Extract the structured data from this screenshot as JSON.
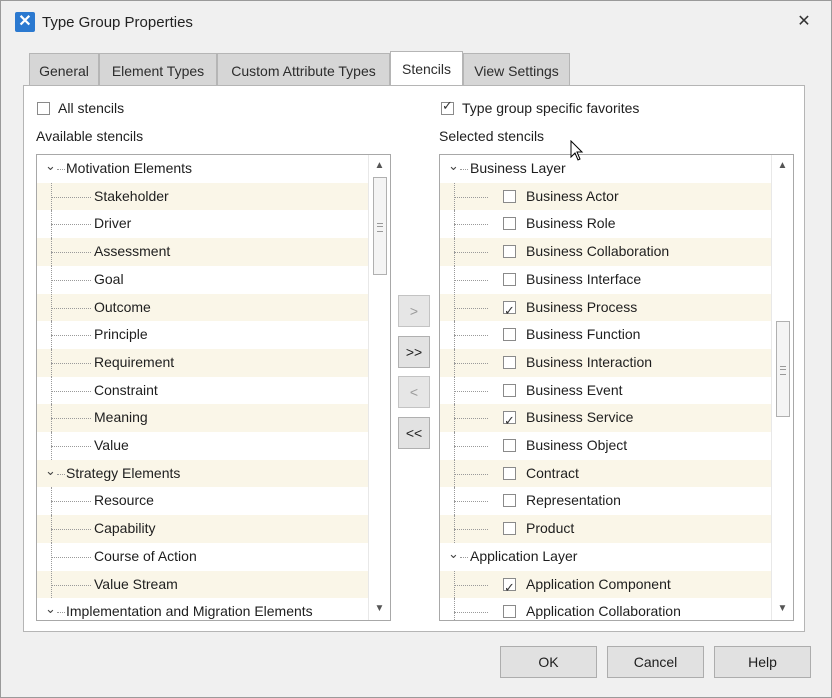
{
  "window": {
    "title": "Type Group Properties"
  },
  "tabs": [
    {
      "label": "General",
      "active": false
    },
    {
      "label": "Element Types",
      "active": false
    },
    {
      "label": "Custom Attribute Types",
      "active": false
    },
    {
      "label": "Stencils",
      "active": true
    },
    {
      "label": "View Settings",
      "active": false
    }
  ],
  "left": {
    "all_stencils_label": "All stencils",
    "all_stencils_checked": false,
    "list_title": "Available stencils",
    "items": [
      {
        "label": "Motivation Elements",
        "group": true
      },
      {
        "label": "Stakeholder"
      },
      {
        "label": "Driver"
      },
      {
        "label": "Assessment"
      },
      {
        "label": "Goal"
      },
      {
        "label": "Outcome"
      },
      {
        "label": "Principle"
      },
      {
        "label": "Requirement"
      },
      {
        "label": "Constraint"
      },
      {
        "label": "Meaning"
      },
      {
        "label": "Value"
      },
      {
        "label": "Strategy Elements",
        "group": true
      },
      {
        "label": "Resource"
      },
      {
        "label": "Capability"
      },
      {
        "label": "Course of Action"
      },
      {
        "label": "Value Stream"
      },
      {
        "label": "Implementation and Migration Elements",
        "group": true
      }
    ]
  },
  "middle": {
    "add_label": ">",
    "add_all_label": ">>",
    "remove_label": "<",
    "remove_all_label": "<<"
  },
  "right": {
    "favorites_label": "Type group specific favorites",
    "favorites_checked": true,
    "list_title": "Selected stencils",
    "items": [
      {
        "label": "Business Layer",
        "group": true
      },
      {
        "label": "Business Actor",
        "checked": false
      },
      {
        "label": "Business Role",
        "checked": false
      },
      {
        "label": "Business Collaboration",
        "checked": false
      },
      {
        "label": "Business Interface",
        "checked": false
      },
      {
        "label": "Business Process",
        "checked": true
      },
      {
        "label": "Business Function",
        "checked": false
      },
      {
        "label": "Business Interaction",
        "checked": false
      },
      {
        "label": "Business Event",
        "checked": false
      },
      {
        "label": "Business Service",
        "checked": true
      },
      {
        "label": "Business Object",
        "checked": false
      },
      {
        "label": "Contract",
        "checked": false
      },
      {
        "label": "Representation",
        "checked": false
      },
      {
        "label": "Product",
        "checked": false
      },
      {
        "label": "Application Layer",
        "group": true
      },
      {
        "label": "Application Component",
        "checked": true
      },
      {
        "label": "Application Collaboration",
        "checked": false
      }
    ]
  },
  "footer": {
    "ok_label": "OK",
    "cancel_label": "Cancel",
    "help_label": "Help"
  }
}
